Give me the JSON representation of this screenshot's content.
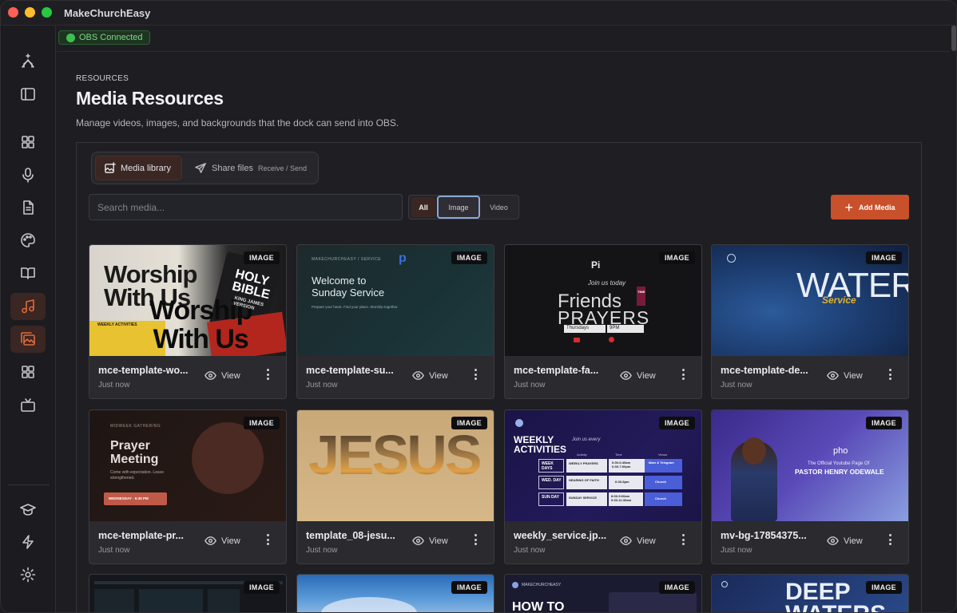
{
  "app": {
    "title": "MakeChurchEasy"
  },
  "status": {
    "obs_label": "OBS Connected"
  },
  "page": {
    "eyebrow": "RESOURCES",
    "title": "Media Resources",
    "description": "Manage videos, images, and backgrounds that the dock can send into OBS."
  },
  "tabs": {
    "media_library": "Media library",
    "share_files": "Share files",
    "share_files_sub": "Receive / Send"
  },
  "search": {
    "placeholder": "Search media...",
    "value": ""
  },
  "filters": {
    "all": "All",
    "image": "Image",
    "video": "Video",
    "selected": "Image"
  },
  "actions": {
    "add_media": "Add Media"
  },
  "card_labels": {
    "view": "View",
    "badge": "IMAGE"
  },
  "media": [
    {
      "name": "mce-template-wo...",
      "time": "Just now",
      "type": "IMAGE",
      "thumb_text": [
        "Worship",
        "With Us",
        "Worship",
        "With Us",
        "HOLY",
        "BIBLE",
        "KING JAMES",
        "VERSION",
        "WEEKLY ACTIVITIES"
      ]
    },
    {
      "name": "mce-template-su...",
      "time": "Just now",
      "type": "IMAGE",
      "thumb_text": [
        "MAKECHURCHEASY / SERVICE",
        "Welcome to",
        "Sunday Service",
        "Prepare your heart. Find your place. Worship together."
      ]
    },
    {
      "name": "mce-template-fa...",
      "time": "Just now",
      "type": "IMAGE",
      "thumb_text": [
        "Join us today",
        "Friends",
        "PRAYERS",
        "Thursdays",
        "9PM",
        "TIME"
      ]
    },
    {
      "name": "mce-template-de...",
      "time": "Just now",
      "type": "IMAGE",
      "thumb_text": [
        "WATERS",
        "Service"
      ]
    },
    {
      "name": "mce-template-pr...",
      "time": "Just now",
      "type": "IMAGE",
      "thumb_text": [
        "MIDWEEK GATHERING",
        "Prayer",
        "Meeting",
        "Come with expectation. Leave strengthened.",
        "WEDNESDAY · 6:30 PM"
      ]
    },
    {
      "name": "template_08-jesu...",
      "time": "Just now",
      "type": "IMAGE",
      "thumb_text": [
        "JESUS"
      ]
    },
    {
      "name": "weekly_service.jp...",
      "time": "Just now",
      "type": "IMAGE",
      "thumb_text": [
        "WEEKLY",
        "ACTIVITIES",
        "Join us every",
        "Activity",
        "Time",
        "Venue",
        "WEEK DAYS",
        "WEEKLY PRAYERS",
        "6:00-6:45am",
        "6:30-7:00pm",
        "Main & Telegram",
        "WED. DAY",
        "HEARING OF FAITH",
        "6:30-8pm",
        "Church",
        "SUN DAY",
        "SUNDAY SERVICE",
        "8:00-9:00am",
        "9:30-11:30am",
        "Church"
      ]
    },
    {
      "name": "mv-bg-17854375...",
      "time": "Just now",
      "type": "IMAGE",
      "thumb_text": [
        "pho",
        "The Official Youtube Page Of",
        "PASTOR HENRY ODEWALE"
      ]
    },
    {
      "name": "",
      "time": "",
      "type": "IMAGE",
      "thumb_text": []
    },
    {
      "name": "",
      "time": "",
      "type": "IMAGE",
      "thumb_text": []
    },
    {
      "name": "",
      "time": "",
      "type": "IMAGE",
      "thumb_text": [
        "MAKECHURCHEASY",
        "HOW TO"
      ]
    },
    {
      "name": "",
      "time": "",
      "type": "IMAGE",
      "thumb_text": [
        "DEEP",
        "WATERS"
      ]
    }
  ]
}
